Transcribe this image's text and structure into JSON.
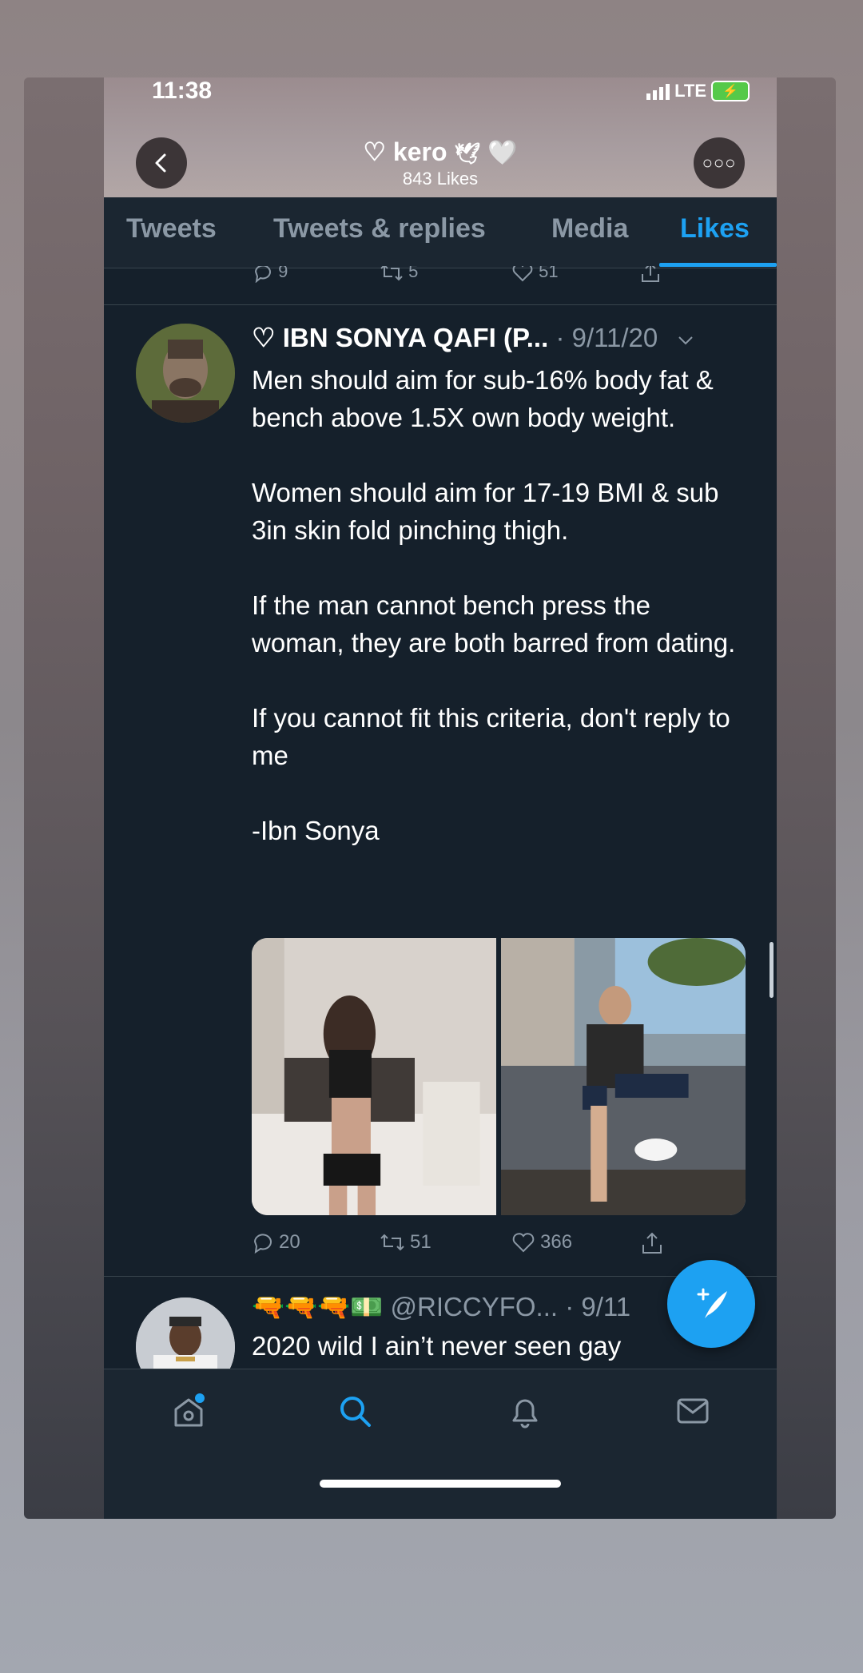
{
  "status_bar": {
    "time": "11:38",
    "network": "LTE"
  },
  "header": {
    "profile_name": "♡ kero",
    "likes_count": "843 Likes",
    "back_icon": "chevron-left-icon",
    "more_icon": "ellipsis-icon"
  },
  "tabs": [
    {
      "label": "Tweets"
    },
    {
      "label": "Tweets & replies"
    },
    {
      "label": "Media"
    },
    {
      "label": "Likes",
      "active": true
    }
  ],
  "prev_tweet_actions": {
    "replies": "9",
    "retweets": "5",
    "likes": "51"
  },
  "tweet": {
    "name": "♡ IBN SONYA QAFI (P...",
    "meta": " · 9/11/20",
    "paragraphs": [
      "Men should aim for sub-16% body fat & bench above 1.5X own body weight.",
      "Women should aim for 17-19 BMI & sub 3in skin fold pinching thigh.",
      "If the man cannot bench press the woman, they are both barred from dating.",
      "If you cannot fit this criteria, don't reply to me",
      "-Ibn Sonya"
    ],
    "replies": "20",
    "retweets": "51",
    "likes": "366"
  },
  "next_tweet": {
    "name": "🔫🔫🔫💵",
    "handle": " @RICCYFO...",
    "meta": " · 9/11",
    "text": "2020 wild I ain’t never seen gay"
  },
  "colors": {
    "background": "#15202b",
    "accent": "#1da1f2",
    "muted": "#8b98a5",
    "divider": "#38444d"
  }
}
